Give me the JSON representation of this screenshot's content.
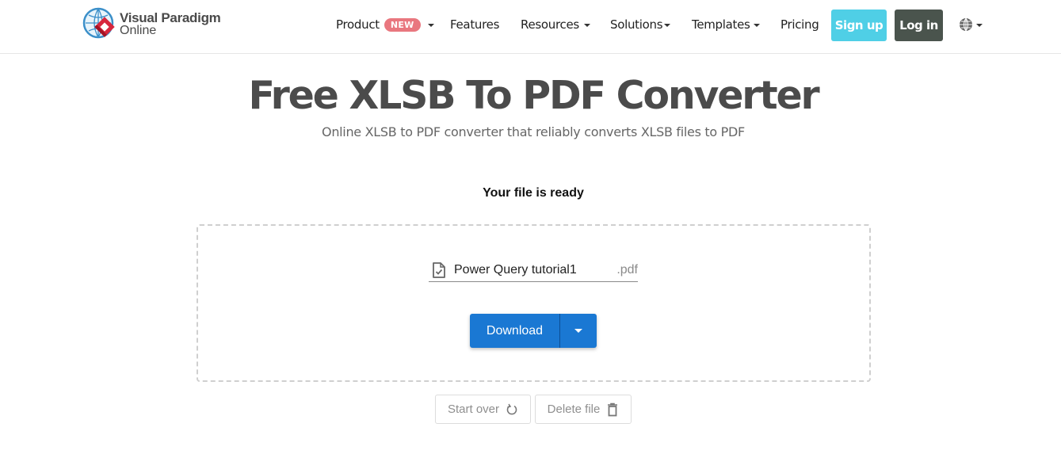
{
  "brand": {
    "name_line1": "Visual Paradigm",
    "name_line2": "Online",
    "logo_icon": "visual-paradigm-globe-logo"
  },
  "nav": {
    "items": [
      {
        "label": "Product",
        "badge": "NEW",
        "has_dropdown": true
      },
      {
        "label": "Features",
        "has_dropdown": false
      },
      {
        "label": "Resources",
        "has_dropdown": true
      },
      {
        "label": "Solutions",
        "has_dropdown": true
      },
      {
        "label": "Templates",
        "has_dropdown": true
      },
      {
        "label": "Pricing",
        "has_dropdown": false
      }
    ],
    "signup_label": "Sign up",
    "login_label": "Log in",
    "language_icon": "globe-icon"
  },
  "hero": {
    "title": "Free XLSB To PDF Converter",
    "subtitle": "Online XLSB to PDF converter that reliably converts XLSB files to PDF"
  },
  "result": {
    "status": "Your file is ready",
    "file_name": "Power Query tutorial1",
    "file_ext": ".pdf",
    "download_label": "Download",
    "start_over_label": "Start over",
    "delete_label": "Delete file"
  },
  "colors": {
    "signup": "#4fcfe6",
    "login": "#4a544d",
    "download": "#1a78d3",
    "new_badge": "#e9777f"
  }
}
